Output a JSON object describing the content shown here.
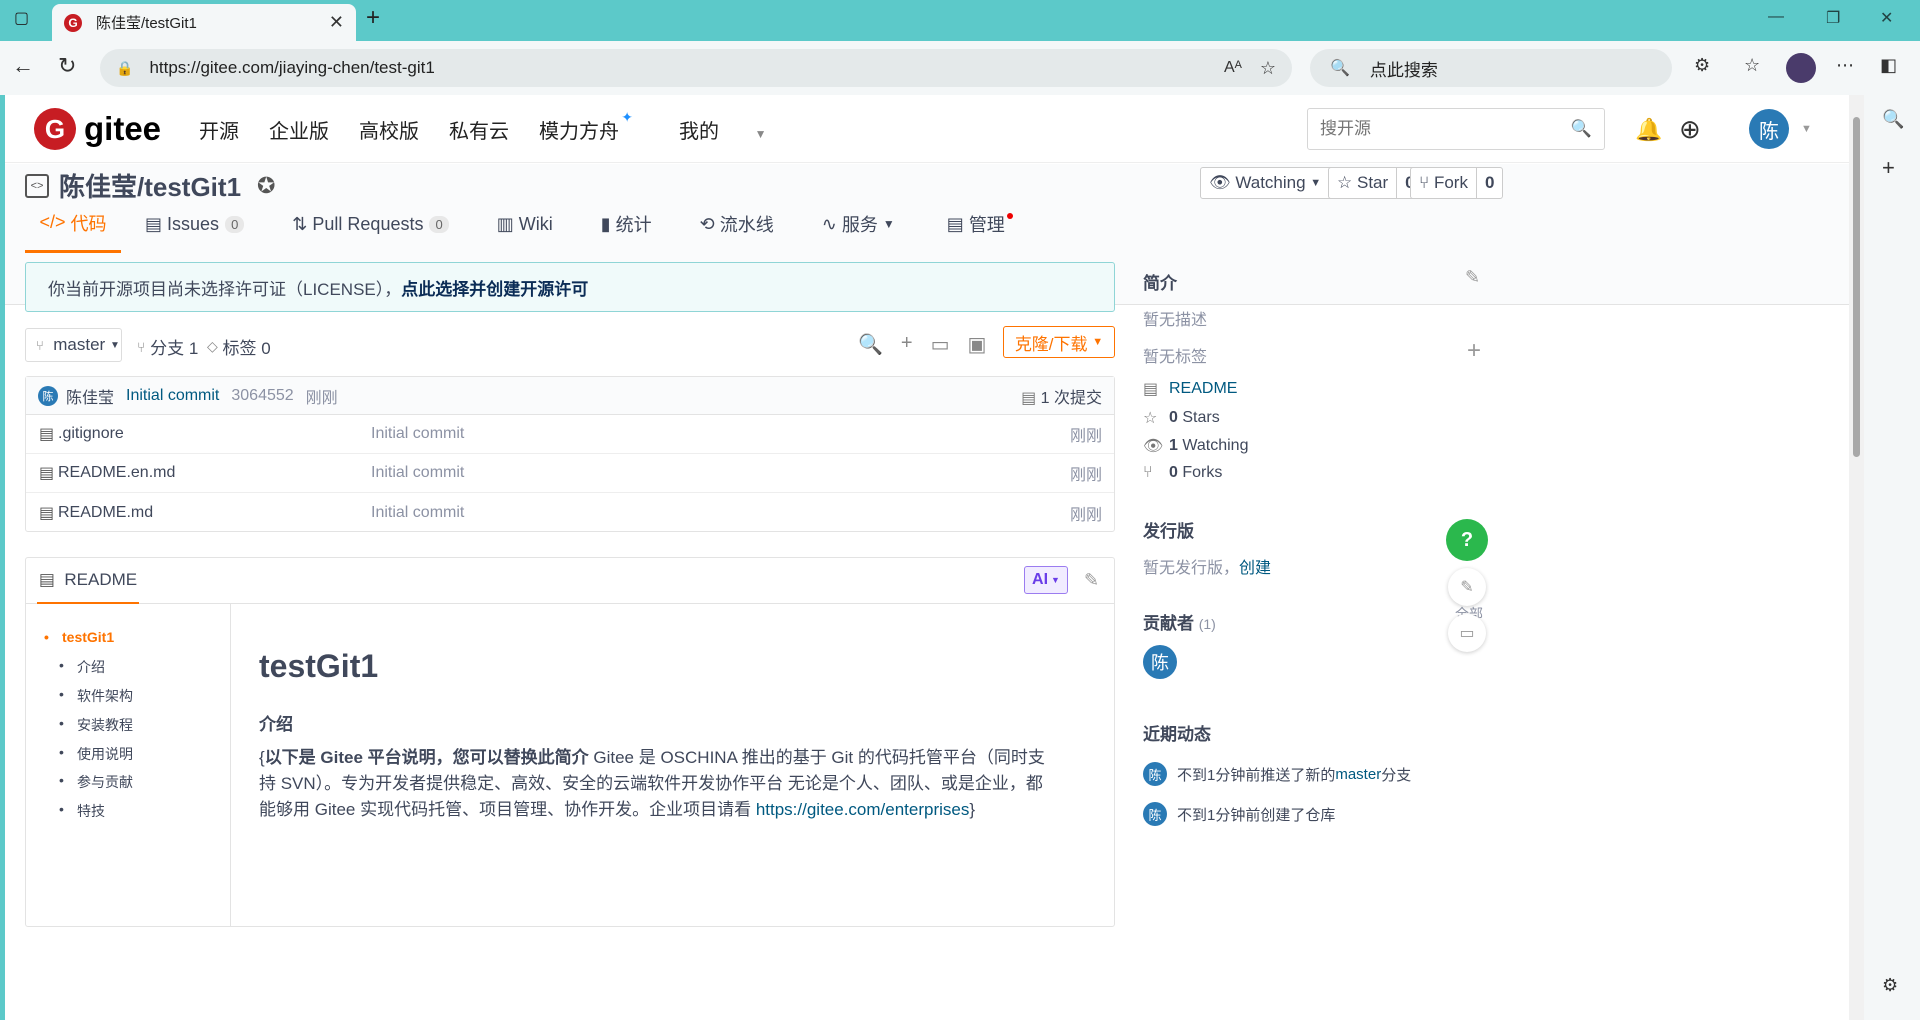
{
  "browser": {
    "tab_title": "陈佳莹/testGit1",
    "tab_favicon": "G",
    "url": "https://gitee.com/jiaying-chen/test-git1",
    "search_placeholder": "点此搜索"
  },
  "header": {
    "logo_text": "gitee",
    "logo_letter": "G",
    "nav": [
      "开源",
      "企业版",
      "高校版",
      "私有云",
      "模力方舟",
      "我的"
    ],
    "search_placeholder": "搜开源",
    "avatar": "陈"
  },
  "repo": {
    "title": "陈佳莹/testGit1",
    "watching_label": "Watching",
    "watching_count": "1",
    "star_label": "Star",
    "star_count": "0",
    "fork_label": "Fork",
    "fork_count": "0",
    "tabs": {
      "code": "代码",
      "issues": "Issues",
      "issues_count": "0",
      "prs": "Pull Requests",
      "prs_count": "0",
      "wiki": "Wiki",
      "stats": "统计",
      "pipeline": "流水线",
      "services": "服务",
      "manage": "管理"
    }
  },
  "license": {
    "text": "你当前开源项目尚未选择许可证（LICENSE），",
    "link": "点此选择并创建开源许可"
  },
  "branch": {
    "name": "master",
    "branches": "分支 1",
    "tags": "标签 0",
    "clone": "克隆/下载"
  },
  "commit": {
    "avatar": "陈",
    "author": "陈佳莹",
    "message": "Initial commit",
    "hash": "3064552",
    "time": "刚刚",
    "count": "1 次提交"
  },
  "files": [
    {
      "name": ".gitignore",
      "message": "Initial commit",
      "time": "刚刚"
    },
    {
      "name": "README.en.md",
      "message": "Initial commit",
      "time": "刚刚"
    },
    {
      "name": "README.md",
      "message": "Initial commit",
      "time": "刚刚"
    }
  ],
  "readme": {
    "tab": "README",
    "ai": "AI",
    "toc": [
      "testGit1",
      "介绍",
      "软件架构",
      "安装教程",
      "使用说明",
      "参与贡献",
      "特技"
    ],
    "h1": "testGit1",
    "h2": "介绍",
    "p_open": "{",
    "p_bold": "以下是 Gitee 平台说明，您可以替换此简介",
    "p_text": " Gitee 是 OSCHINA 推出的基于 Git 的代码托管平台（同时支持 SVN）。专为开发者提供稳定、高效、安全的云端软件开发协作平台 无论是个人、团队、或是企业，都能够用 Gitee 实现代码托管、项目管理、协作开发。企业项目请看 ",
    "p_link": "https://gitee.com/enterprises",
    "p_close": "}"
  },
  "sidebar": {
    "intro_title": "简介",
    "no_desc": "暂无描述",
    "no_tags": "暂无标签",
    "readme": "README",
    "stars_n": "0",
    "stars": "Stars",
    "watching_n": "1",
    "watching": "Watching",
    "forks_n": "0",
    "forks": "Forks",
    "release_title": "发行版",
    "no_release": "暂无发行版，",
    "create": "创建",
    "contrib_title": "贡献者",
    "contrib_count": "(1)",
    "contrib_avatar": "陈",
    "all_partial": "全部",
    "activity_title": "近期动态",
    "act1_pre": "不到1分钟前推送了新的 ",
    "act1_branch": "master",
    "act1_post": " 分支",
    "act2": "不到1分钟前创建了仓库",
    "help": "?"
  },
  "colors": {
    "accent": "#fe7300",
    "brand": "#c71d23",
    "link": "#005980",
    "avatar": "#2a7ab5",
    "help": "#2bb84d"
  }
}
